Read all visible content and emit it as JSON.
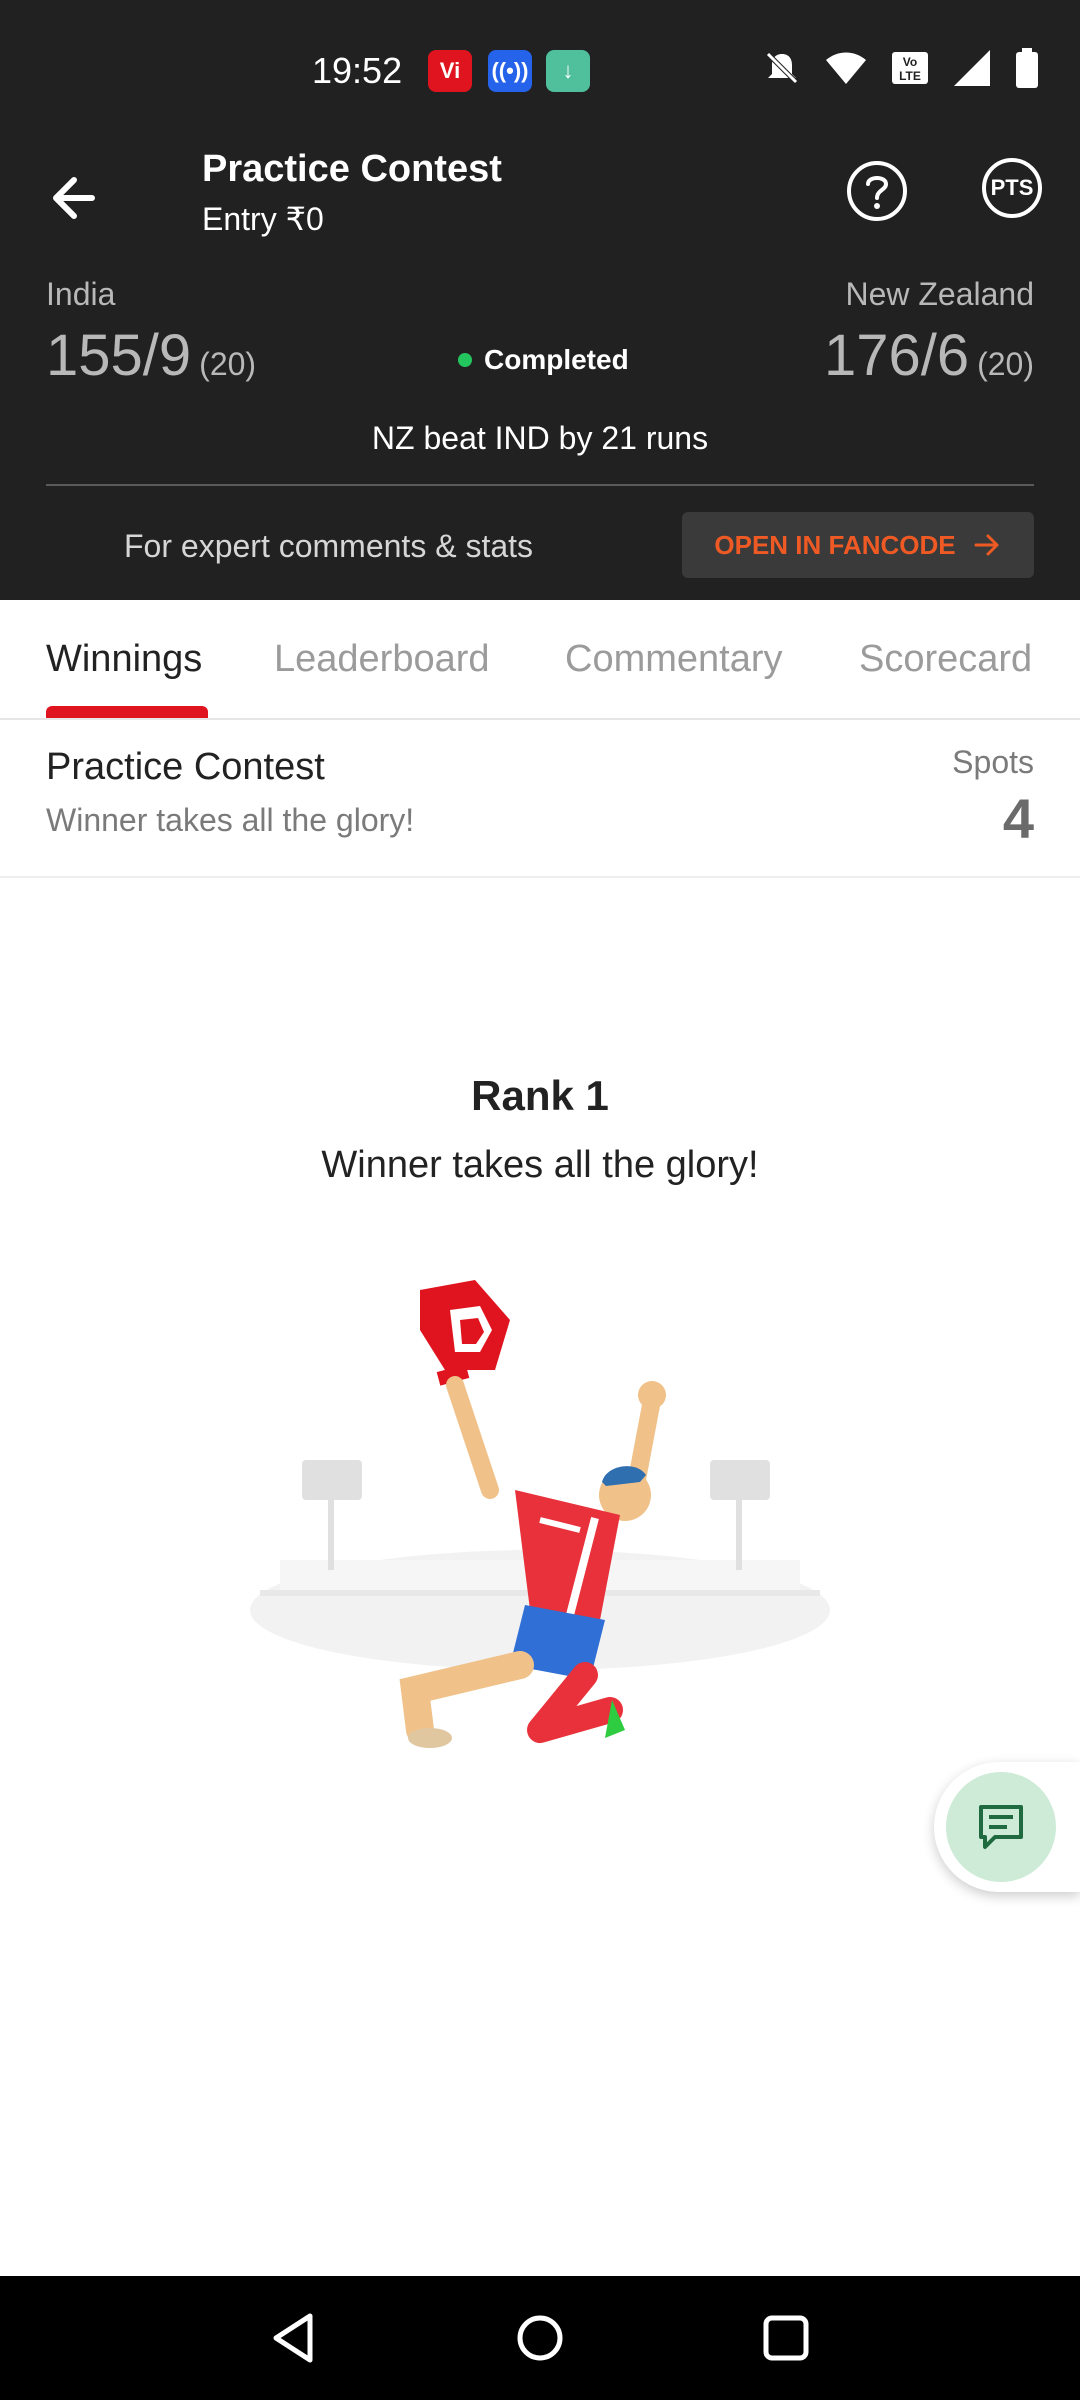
{
  "status_bar": {
    "time": "19:52",
    "app_icons": [
      "vi-icon",
      "broadcast-icon",
      "download-icon"
    ]
  },
  "header": {
    "title": "Practice Contest",
    "subtitle": "Entry ₹0",
    "pts_label": "PTS"
  },
  "match": {
    "team_left": {
      "name": "India",
      "score": "155/9",
      "overs": "(20)"
    },
    "team_right": {
      "name": "New Zealand",
      "score": "176/6",
      "overs": "(20)"
    },
    "status": "Completed",
    "result": "NZ beat IND by 21 runs"
  },
  "promo": {
    "text": "For expert comments & stats",
    "button_label": "OPEN IN FANCODE"
  },
  "tabs": [
    {
      "label": "Winnings",
      "active": true
    },
    {
      "label": "Leaderboard",
      "active": false
    },
    {
      "label": "Commentary",
      "active": false
    },
    {
      "label": "Scorecard",
      "active": false
    }
  ],
  "contest": {
    "name": "Practice Contest",
    "description": "Winner takes all the glory!",
    "spots_label": "Spots",
    "spots_value": "4"
  },
  "rank_card": {
    "title": "Rank 1",
    "description": "Winner takes all the glory!"
  },
  "colors": {
    "header_bg": "#212121",
    "accent_red": "#e0141e",
    "fancode_orange": "#ef5a24",
    "completed_green": "#22c55e",
    "chat_fab_bg": "#cdebd6"
  }
}
